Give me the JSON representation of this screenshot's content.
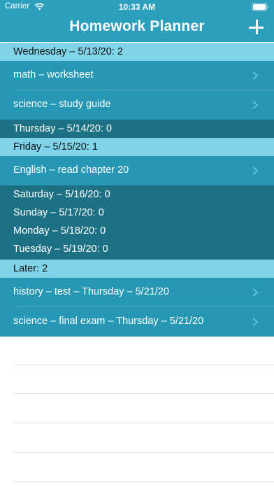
{
  "status": {
    "carrier": "Carrier",
    "time": "10:33 AM"
  },
  "nav": {
    "title": "Homework Planner",
    "add_icon": "plus-icon"
  },
  "sections": [
    {
      "header": "Wednesday – 5/13/20: 2"
    },
    {
      "items": [
        "math – worksheet",
        "science – study guide"
      ]
    },
    {
      "header": "Thursday – 5/14/20: 0"
    },
    {
      "header": "Friday – 5/15/20: 1"
    },
    {
      "items": [
        "English – read chapter 20"
      ]
    },
    {
      "empty": [
        "Saturday – 5/16/20: 0",
        "Sunday – 5/17/20: 0",
        "Monday – 5/18/20: 0",
        "Tuesday – 5/19/20: 0"
      ]
    },
    {
      "header": "Later: 2"
    },
    {
      "items": [
        "history – test – Thursday – 5/21/20",
        "science – final exam – Thursday – 5/21/20"
      ]
    }
  ],
  "list": {
    "headers": [
      "Wednesday – 5/13/20: 2",
      "Thursday – 5/14/20: 0",
      "Friday – 5/15/20: 1",
      "Saturday – 5/16/20: 0",
      "Sunday – 5/17/20: 0",
      "Monday – 5/18/20: 0",
      "Tuesday – 5/19/20: 0",
      "Later: 2"
    ],
    "items": [
      "math – worksheet",
      "science – study guide",
      "English – read chapter 20",
      "history – test – Thursday – 5/21/20",
      "science – final exam – Thursday – 5/21/20"
    ]
  },
  "colors": {
    "nav_bg": "#2c9fbd",
    "section_header_bg": "#7fd4ea",
    "item_bg": "#2698b5",
    "empty_section_bg": "#1d7185"
  }
}
